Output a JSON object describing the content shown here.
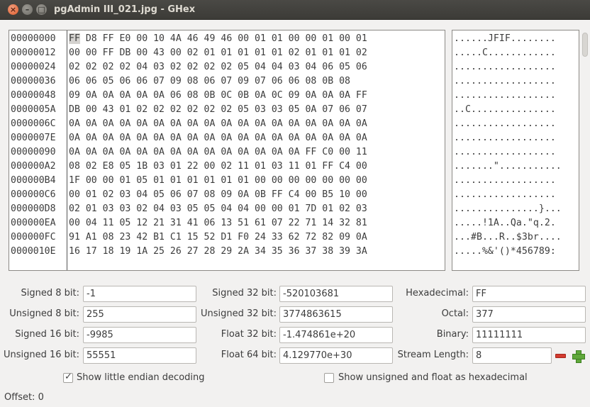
{
  "window": {
    "title": "pgAdmin III_021.jpg - GHex",
    "close_glyph": "×",
    "minimize_glyph": "–",
    "maximize_glyph": "□"
  },
  "hex": {
    "rows": [
      {
        "offset": "00000000",
        "bytes": "FF D8 FF E0 00 10 4A 46 49 46 00 01 01 00 00 01 00 01",
        "ascii": "......JFIF........"
      },
      {
        "offset": "00000012",
        "bytes": "00 00 FF DB 00 43 00 02 01 01 01 01 01 02 01 01 01 02",
        "ascii": ".....C............"
      },
      {
        "offset": "00000024",
        "bytes": "02 02 02 02 04 03 02 02 02 02 05 04 04 03 04 06 05 06",
        "ascii": ".................."
      },
      {
        "offset": "00000036",
        "bytes": "06 06 05 06 06 07 09 08 06 07 09 07 06 06 08 0B 08",
        "ascii": ".................."
      },
      {
        "offset": "00000048",
        "bytes": "09 0A 0A 0A 0A 0A 06 08 0B 0C 0B 0A 0C 09 0A 0A 0A FF",
        "ascii": ".................."
      },
      {
        "offset": "0000005A",
        "bytes": "DB 00 43 01 02 02 02 02 02 02 05 03 03 05 0A 07 06 07",
        "ascii": "..C..............."
      },
      {
        "offset": "0000006C",
        "bytes": "0A 0A 0A 0A 0A 0A 0A 0A 0A 0A 0A 0A 0A 0A 0A 0A 0A 0A",
        "ascii": ".................."
      },
      {
        "offset": "0000007E",
        "bytes": "0A 0A 0A 0A 0A 0A 0A 0A 0A 0A 0A 0A 0A 0A 0A 0A 0A 0A",
        "ascii": ".................."
      },
      {
        "offset": "00000090",
        "bytes": "0A 0A 0A 0A 0A 0A 0A 0A 0A 0A 0A 0A 0A 0A FF C0 00 11",
        "ascii": ".................."
      },
      {
        "offset": "000000A2",
        "bytes": "08 02 E8 05 1B 03 01 22 00 02 11 01 03 11 01 FF C4 00",
        "ascii": ".......\"..........."
      },
      {
        "offset": "000000B4",
        "bytes": "1F 00 00 01 05 01 01 01 01 01 01 00 00 00 00 00 00 00",
        "ascii": ".................."
      },
      {
        "offset": "000000C6",
        "bytes": "00 01 02 03 04 05 06 07 08 09 0A 0B FF C4 00 B5 10 00",
        "ascii": ".................."
      },
      {
        "offset": "000000D8",
        "bytes": "02 01 03 03 02 04 03 05 05 04 04 00 00 01 7D 01 02 03",
        "ascii": "...............}..."
      },
      {
        "offset": "000000EA",
        "bytes": "00 04 11 05 12 21 31 41 06 13 51 61 07 22 71 14 32 81",
        "ascii": ".....!1A..Qa.\"q.2."
      },
      {
        "offset": "000000FC",
        "bytes": "91 A1 08 23 42 B1 C1 15 52 D1 F0 24 33 62 72 82 09 0A",
        "ascii": "...#B...R..$3br...."
      },
      {
        "offset": "0000010E",
        "bytes": "16 17 18 19 1A 25 26 27 28 29 2A 34 35 36 37 38 39 3A",
        "ascii": ".....%&'()*456789:"
      }
    ]
  },
  "decoding": {
    "signed8_label": "Signed 8 bit:",
    "signed8_value": "-1",
    "unsigned8_label": "Unsigned 8 bit:",
    "unsigned8_value": "255",
    "signed16_label": "Signed 16 bit:",
    "signed16_value": "-9985",
    "unsigned16_label": "Unsigned 16 bit:",
    "unsigned16_value": "55551",
    "signed32_label": "Signed 32 bit:",
    "signed32_value": "-520103681",
    "unsigned32_label": "Unsigned 32 bit:",
    "unsigned32_value": "3774863615",
    "float32_label": "Float 32 bit:",
    "float32_value": "-1.474861e+20",
    "float64_label": "Float 64 bit:",
    "float64_value": "4.129770e+30",
    "hex_label": "Hexadecimal:",
    "hex_value": "FF",
    "octal_label": "Octal:",
    "octal_value": "377",
    "binary_label": "Binary:",
    "binary_value": "11111111",
    "stream_label": "Stream Length:",
    "stream_value": "8"
  },
  "options": {
    "little_endian_label": "Show little endian decoding",
    "little_endian_checked": true,
    "unsigned_hex_label": "Show unsigned and float as hexadecimal",
    "unsigned_hex_checked": false
  },
  "status": {
    "offset_text": "Offset: 0"
  },
  "icons": {
    "close": "close-icon",
    "minimize": "minimize-icon",
    "maximize": "maximize-icon",
    "decrement": "minus-icon",
    "increment": "plus-icon",
    "check": "check-icon"
  },
  "colors": {
    "titlebar": "#3c3b37",
    "close_button": "#df5a2a",
    "minus": "#d33b2f",
    "plus": "#5fa83a",
    "window_bg": "#f2f1f0"
  }
}
